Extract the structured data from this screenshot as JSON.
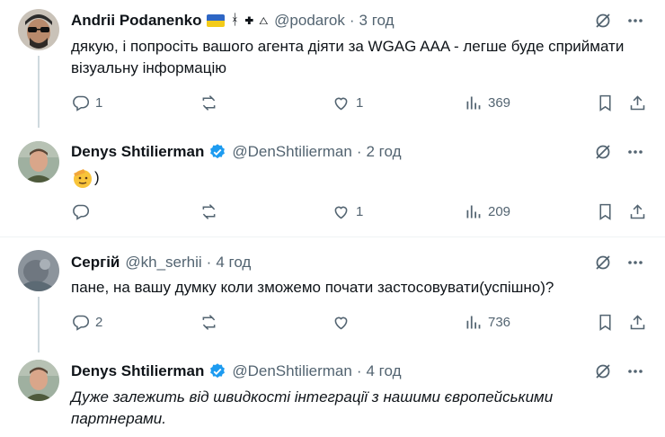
{
  "tweets": [
    {
      "name": "Andrii Podanenko",
      "handle": "@podarok",
      "dot": "·",
      "time": "3 год",
      "extra_symbols": "ᚼ ✚ △",
      "text": "дякую, і попросіть вашого агента діяти за WGAG AAA - легше буде сприймати візуальну інформацію",
      "replies": "1",
      "reposts": "",
      "likes": "1",
      "views": "369"
    },
    {
      "name": "Denys Shtilierman",
      "handle": "@DenShtilierman",
      "dot": "·",
      "time": "2 год",
      "text": ")",
      "replies": "",
      "reposts": "",
      "likes": "1",
      "views": "209"
    },
    {
      "name": "Сергій",
      "handle": "@kh_serhii",
      "dot": "·",
      "time": "4 год",
      "text": "пане, на вашу думку коли зможемо почати застосовувати(успішно)?",
      "replies": "2",
      "reposts": "",
      "likes": "",
      "views": "736"
    },
    {
      "name": "Denys Shtilierman",
      "handle": "@DenShtilierman",
      "dot": "·",
      "time": "4 год",
      "text": "Дуже залежить від швидкості інтеграції з нашими європейськими партнерами."
    }
  ],
  "colors": {
    "text": "#0f1419",
    "muted": "#536471",
    "verified": "#1d9bf0",
    "thread_line": "#cfd9de",
    "separator": "#eff3f4"
  },
  "icons": [
    "reply-icon",
    "repost-icon",
    "like-icon",
    "views-icon",
    "bookmark-icon",
    "share-icon",
    "grok-icon",
    "more-icon",
    "verified-badge-icon"
  ]
}
